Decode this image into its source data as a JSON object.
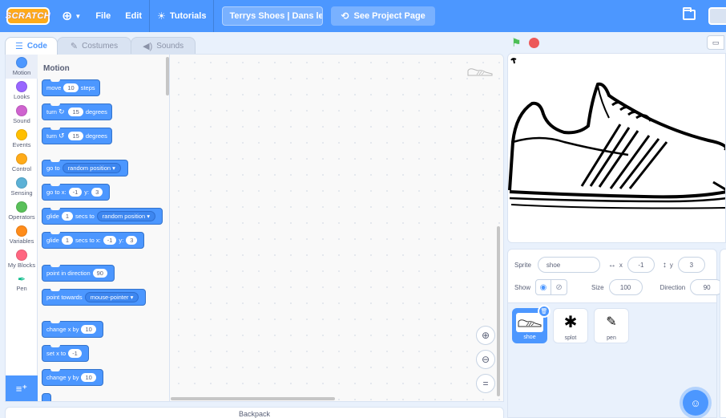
{
  "menubar": {
    "logo": "SCRATCH",
    "file": "File",
    "edit": "Edit",
    "tutorials": "Tutorials",
    "project_title": "Terrys Shoes | Dans les C...",
    "see_project": "See Project Page"
  },
  "tabs": {
    "code": "Code",
    "costumes": "Costumes",
    "sounds": "Sounds"
  },
  "categories": [
    {
      "label": "Motion",
      "color": "#4c97ff"
    },
    {
      "label": "Looks",
      "color": "#9966ff"
    },
    {
      "label": "Sound",
      "color": "#cf63cf"
    },
    {
      "label": "Events",
      "color": "#ffbf00"
    },
    {
      "label": "Control",
      "color": "#ffab19"
    },
    {
      "label": "Sensing",
      "color": "#5cb1d6"
    },
    {
      "label": "Operators",
      "color": "#59c059"
    },
    {
      "label": "Variables",
      "color": "#ff8c1a"
    },
    {
      "label": "My Blocks",
      "color": "#ff6680"
    },
    {
      "label": "Pen",
      "color": "#0fbd8c"
    }
  ],
  "palette": {
    "title": "Motion",
    "move": {
      "pre": "move",
      "val": "10",
      "post": "steps"
    },
    "turn_right": {
      "pre": "turn",
      "val": "15",
      "post": "degrees"
    },
    "turn_left": {
      "pre": "turn",
      "val": "15",
      "post": "degrees"
    },
    "go_to": {
      "pre": "go to",
      "dd": "random position ▾"
    },
    "go_to_xy": {
      "pre": "go to x:",
      "x": "-1",
      "mid": "y:",
      "y": "3"
    },
    "glide_to": {
      "pre": "glide",
      "val": "1",
      "mid": "secs to",
      "dd": "random position ▾"
    },
    "glide_xy": {
      "pre": "glide",
      "val": "1",
      "mid": "secs to x:",
      "x": "-1",
      "mid2": "y:",
      "y": "3"
    },
    "point_dir": {
      "pre": "point in direction",
      "val": "90"
    },
    "point_towards": {
      "pre": "point towards",
      "dd": "mouse-pointer ▾"
    },
    "change_x": {
      "pre": "change x by",
      "val": "10"
    },
    "set_x": {
      "pre": "set x to",
      "val": "-1"
    },
    "change_y": {
      "pre": "change y by",
      "val": "10"
    }
  },
  "backpack": "Backpack",
  "sprite_info": {
    "sprite_label": "Sprite",
    "sprite_name": "shoe",
    "x_label": "x",
    "x_value": "-1",
    "y_label": "y",
    "y_value": "3",
    "show_label": "Show",
    "size_label": "Size",
    "size_value": "100",
    "direction_label": "Direction",
    "direction_value": "90"
  },
  "sprites": [
    {
      "name": "shoe",
      "selected": true
    },
    {
      "name": "splot",
      "selected": false
    },
    {
      "name": "pen",
      "selected": false
    }
  ]
}
